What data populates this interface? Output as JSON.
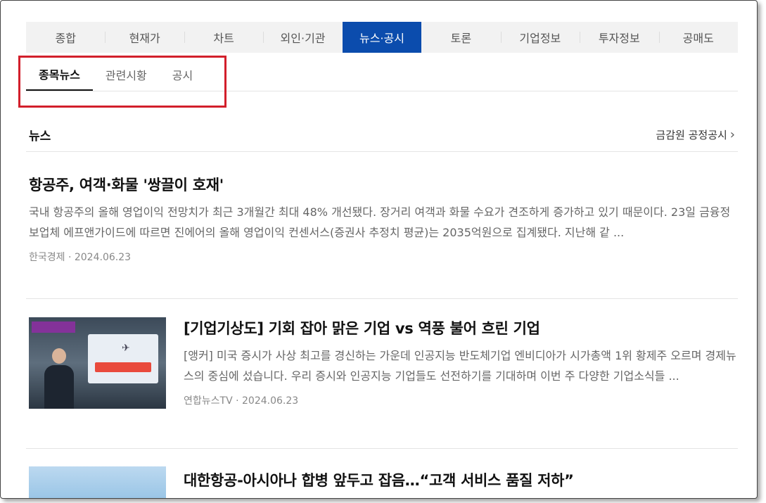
{
  "tabs": [
    "종합",
    "현재가",
    "차트",
    "외인·기관",
    "뉴스·공시",
    "토론",
    "기업정보",
    "투자정보",
    "공매도"
  ],
  "subtabs": [
    "종목뉴스",
    "관련시황",
    "공시"
  ],
  "section": {
    "title": "뉴스",
    "link": "금감원 공정공시"
  },
  "articles": [
    {
      "title": "항공주, 여객·화물 '쌍끌이 호재'",
      "body": "국내 항공주의 올해 영업이익 전망치가 최근 3개월간 최대 48% 개선됐다. 장거리 여객과 화물 수요가 견조하게 증가하고 있기 때문이다. 23일 금융정보업체 에프앤가이드에 따르면 진에어의 올해 영업이익 컨센서스(증권사 추정치 평균)는 2035억원으로 집계됐다. 지난해 같 ...",
      "meta": "한국경제 · 2024.06.23"
    },
    {
      "title": "[기업기상도] 기회 잡아 맑은 기업 vs 역풍 불어 흐린 기업",
      "body": "[앵커] 미국 증시가 사상 최고를 경신하는 가운데 인공지능 반도체기업 엔비디아가 시가총액 1위 황제주 오르며 경제뉴스의 중심에 섰습니다. 우리 증시와 인공지능 기업들도 선전하기를 기대하며 이번 주 다양한 기업소식들 ...",
      "meta": "연합뉴스TV · 2024.06.23"
    },
    {
      "title": "대한항공-아시아나 합병 앞두고 잡음…“고객 서비스 품질 저하”"
    }
  ]
}
